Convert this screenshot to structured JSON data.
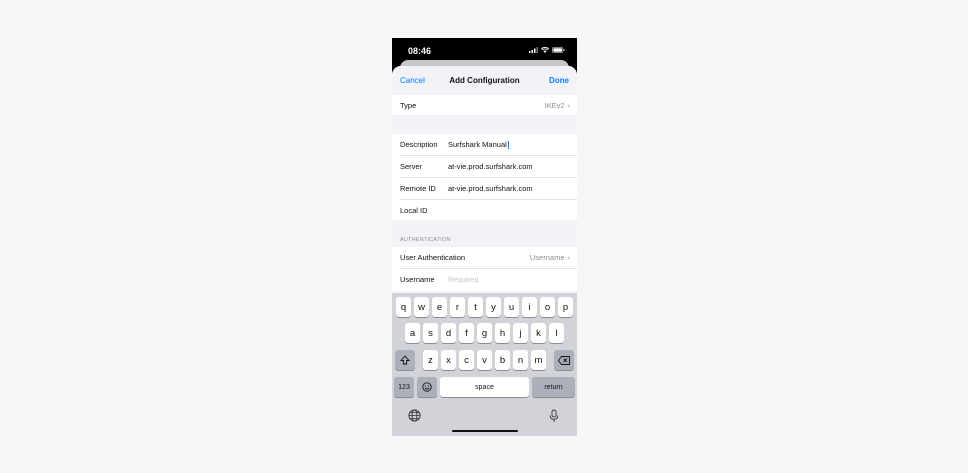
{
  "status": {
    "time": "08:46"
  },
  "nav": {
    "cancel": "Cancel",
    "title": "Add Configuration",
    "done": "Done"
  },
  "type_row": {
    "label": "Type",
    "value": "IKEv2"
  },
  "fields": {
    "description": {
      "label": "Description",
      "value": "Surfshark Manual"
    },
    "server": {
      "label": "Server",
      "value": "at-vie.prod.surfshark.com"
    },
    "remote_id": {
      "label": "Remote ID",
      "value": "at-vie.prod.surfshark.com"
    },
    "local_id": {
      "label": "Local ID",
      "value": ""
    }
  },
  "auth": {
    "section": "AUTHENTICATION",
    "user_auth": {
      "label": "User Authentication",
      "value": "Username"
    },
    "username": {
      "label": "Username",
      "placeholder": "Required"
    }
  },
  "keyboard": {
    "row1": [
      "q",
      "w",
      "e",
      "r",
      "t",
      "y",
      "u",
      "i",
      "o",
      "p"
    ],
    "row2": [
      "a",
      "s",
      "d",
      "f",
      "g",
      "h",
      "j",
      "k",
      "l"
    ],
    "row3": [
      "z",
      "x",
      "c",
      "v",
      "b",
      "n",
      "m"
    ],
    "numbers": "123",
    "space": "space",
    "return": "return"
  },
  "colors": {
    "accent": "#0a7cff",
    "background": "#f2f2f7",
    "keyboard": "#d1d3d9"
  }
}
